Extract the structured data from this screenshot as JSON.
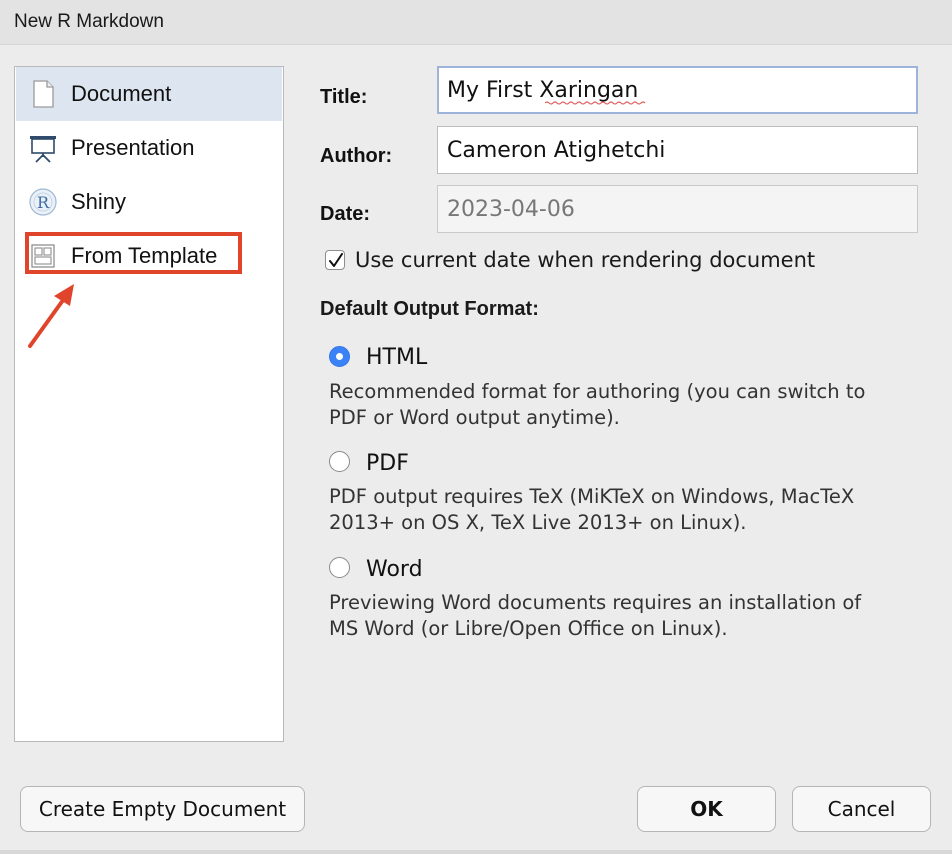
{
  "window": {
    "title": "New R Markdown"
  },
  "sidebar": {
    "items": [
      {
        "label": "Document",
        "icon": "document-icon",
        "selected": true
      },
      {
        "label": "Presentation",
        "icon": "presentation-icon",
        "selected": false
      },
      {
        "label": "Shiny",
        "icon": "shiny-r-icon",
        "selected": false
      },
      {
        "label": "From Template",
        "icon": "template-icon",
        "selected": false
      }
    ],
    "annotation": {
      "highlight_color": "#e0452c"
    }
  },
  "form": {
    "title_label": "Title:",
    "title_value": "My First Xaringan",
    "author_label": "Author:",
    "author_value": "Cameron Atighetchi",
    "date_label": "Date:",
    "date_value": "2023-04-06",
    "use_current_date_label": "Use current date when rendering document",
    "use_current_date_checked": true
  },
  "output": {
    "heading": "Default Output Format:",
    "options": [
      {
        "label": "HTML",
        "selected": true,
        "desc1": "Recommended format for authoring (you can switch to",
        "desc2": "PDF or Word output anytime)."
      },
      {
        "label": "PDF",
        "selected": false,
        "desc1": "PDF output requires TeX (MiKTeX on Windows, MacTeX",
        "desc2": "2013+ on OS X, TeX Live 2013+ on Linux)."
      },
      {
        "label": "Word",
        "selected": false,
        "desc1": "Previewing Word documents requires an installation of",
        "desc2": "MS Word (or Libre/Open Office on Linux)."
      }
    ]
  },
  "buttons": {
    "create_empty": "Create Empty Document",
    "ok": "OK",
    "cancel": "Cancel"
  },
  "colors": {
    "accent": "#3b82f6",
    "selection": "#dde6f0"
  }
}
